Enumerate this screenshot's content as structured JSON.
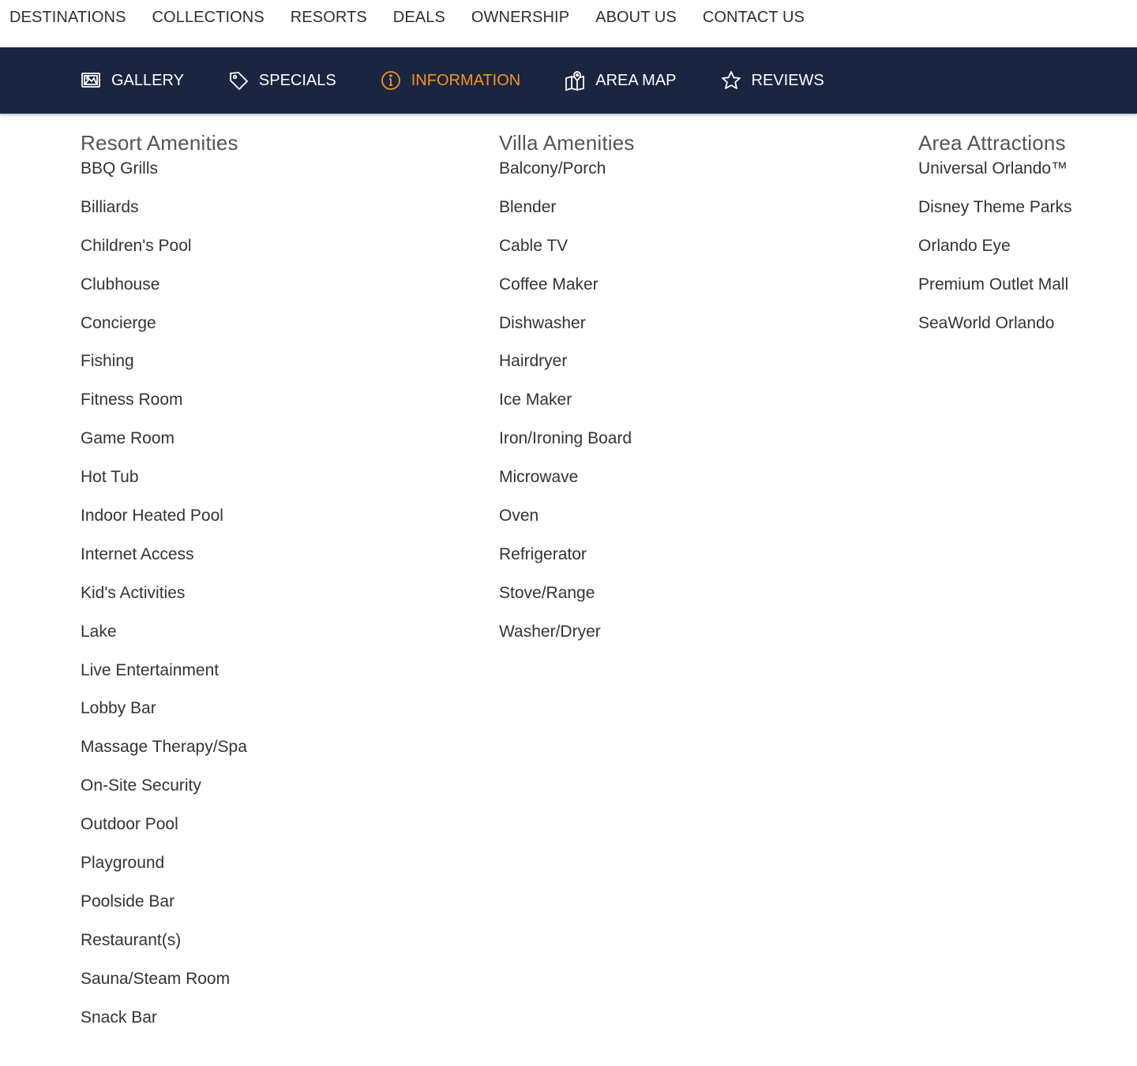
{
  "top_nav": {
    "items": [
      "DESTINATIONS",
      "COLLECTIONS",
      "RESORTS",
      "DEALS",
      "OWNERSHIP",
      "ABOUT US",
      "CONTACT US"
    ]
  },
  "sub_nav": {
    "items": [
      {
        "label": "GALLERY",
        "icon": "gallery-icon",
        "active": false
      },
      {
        "label": "SPECIALS",
        "icon": "tag-icon",
        "active": false
      },
      {
        "label": "INFORMATION",
        "icon": "info-icon",
        "active": true
      },
      {
        "label": "AREA MAP",
        "icon": "map-icon",
        "active": false
      },
      {
        "label": "REVIEWS",
        "icon": "star-icon",
        "active": false
      }
    ],
    "colors": {
      "background": "#1a2540",
      "text": "#ffffff",
      "active": "#f7941d"
    }
  },
  "resort_amenities": {
    "title": "Resort Amenities",
    "items": [
      "BBQ Grills",
      "Billiards",
      "Children's Pool",
      "Clubhouse",
      "Concierge",
      "Fishing",
      "Fitness Room",
      "Game Room",
      "Hot Tub",
      "Indoor Heated Pool",
      "Internet Access",
      "Kid's Activities",
      "Lake",
      "Live Entertainment",
      "Lobby Bar",
      "Massage Therapy/Spa",
      "On-Site Security",
      "Outdoor Pool",
      "Playground",
      "Poolside Bar",
      "Restaurant(s)",
      "Sauna/Steam Room",
      "Snack Bar"
    ]
  },
  "villa_amenities": {
    "title": "Villa Amenities",
    "items": [
      "Balcony/Porch",
      "Blender",
      "Cable TV",
      "Coffee Maker",
      "Dishwasher",
      "Hairdryer",
      "Ice Maker",
      "Iron/Ironing Board",
      "Microwave",
      "Oven",
      "Refrigerator",
      "Stove/Range",
      "Washer/Dryer"
    ]
  },
  "area_attractions": {
    "title": "Area Attractions",
    "items": [
      "Universal Orlando™",
      "Disney Theme Parks",
      "Orlando Eye",
      "Premium Outlet Mall",
      "SeaWorld Orlando"
    ]
  }
}
